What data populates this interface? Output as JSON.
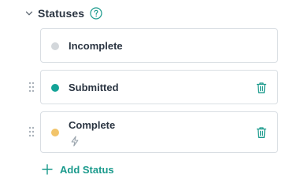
{
  "section": {
    "title": "Statuses",
    "help_icon": "question-circle-icon",
    "collapse_icon": "chevron-down-icon"
  },
  "statuses": [
    {
      "label": "Incomplete",
      "color": "#d3d7db",
      "draggable": false,
      "deletable": false,
      "has_automation": false
    },
    {
      "label": "Submitted",
      "color": "#14a397",
      "draggable": true,
      "deletable": true,
      "has_automation": false
    },
    {
      "label": "Complete",
      "color": "#f2c46a",
      "draggable": true,
      "deletable": true,
      "has_automation": true
    }
  ],
  "add_status": {
    "label": "Add Status",
    "icon": "plus-icon"
  },
  "colors": {
    "accent": "#1a9a8c",
    "text": "#2b3542",
    "border": "#d9dee3",
    "muted_icon": "#9aa4ad"
  }
}
